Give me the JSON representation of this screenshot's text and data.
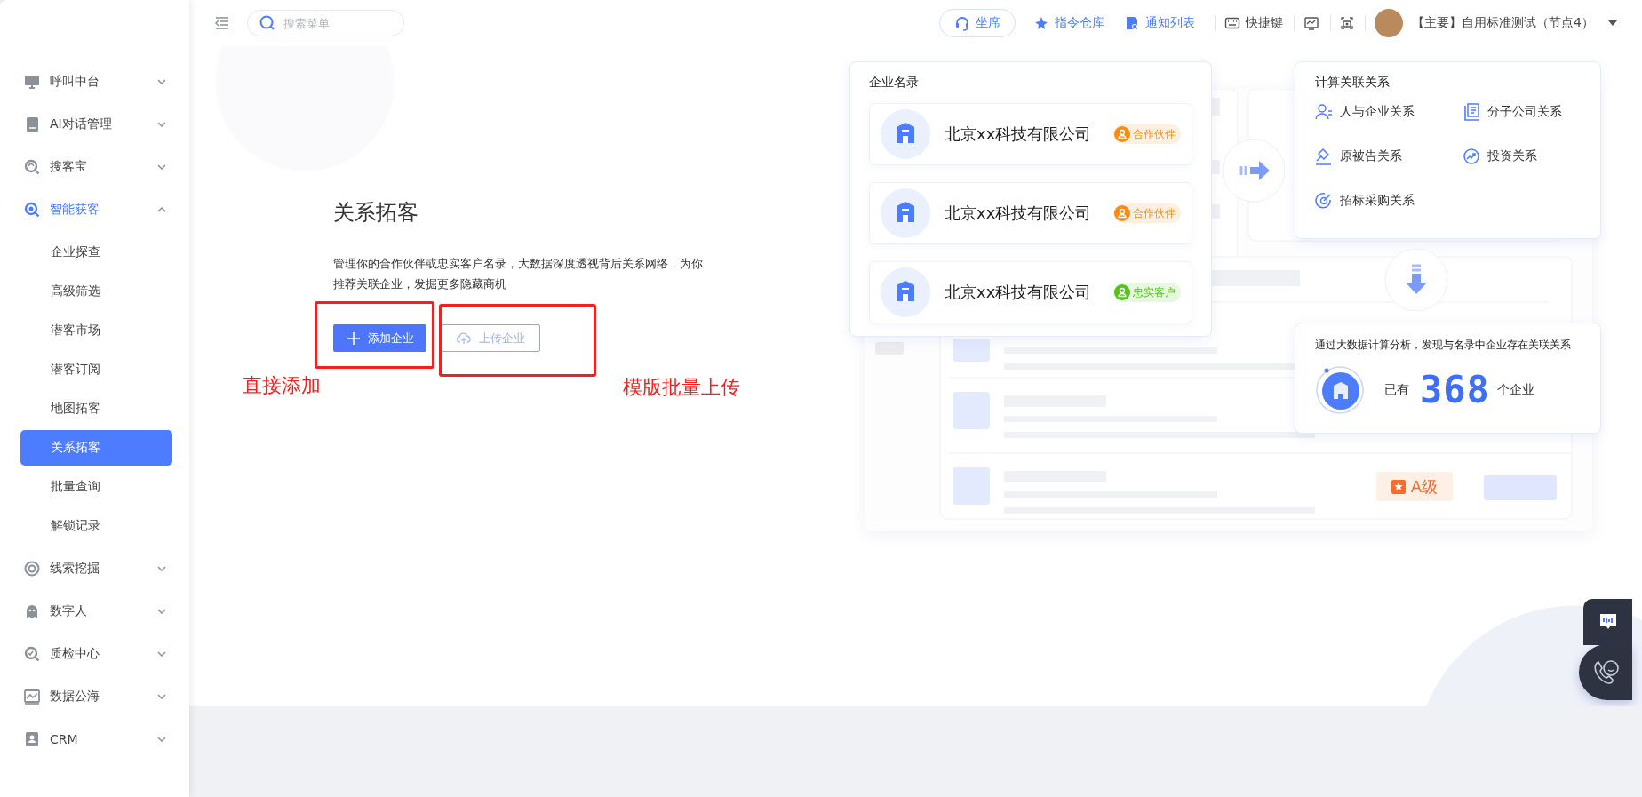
{
  "topbar": {
    "search": {
      "placeholder": "搜索菜单"
    },
    "actions": [
      {
        "label": "坐席",
        "kind": "pill"
      },
      {
        "label": "指令仓库",
        "kind": "link"
      },
      {
        "label": "通知列表",
        "kind": "link"
      },
      {
        "label": "快捷键",
        "kind": "plain"
      }
    ],
    "user": {
      "name": "【主要】自用标准测试（节点4）"
    }
  },
  "sidebar": {
    "items": [
      {
        "label": "呼叫中台",
        "expanded": false
      },
      {
        "label": "AI对话管理",
        "expanded": false
      },
      {
        "label": "搜客宝",
        "expanded": false
      },
      {
        "label": "智能获客",
        "expanded": true,
        "children": [
          {
            "label": "企业探查",
            "selected": false
          },
          {
            "label": "高级筛选",
            "selected": false
          },
          {
            "label": "潜客市场",
            "selected": false
          },
          {
            "label": "潜客订阅",
            "selected": false
          },
          {
            "label": "地图拓客",
            "selected": false
          },
          {
            "label": "关系拓客",
            "selected": true
          },
          {
            "label": "批量查询",
            "selected": false
          },
          {
            "label": "解锁记录",
            "selected": false
          }
        ]
      },
      {
        "label": "线索挖掘",
        "expanded": false
      },
      {
        "label": "数字人",
        "expanded": false
      },
      {
        "label": "质检中心",
        "expanded": false
      },
      {
        "label": "数据公海",
        "expanded": false
      },
      {
        "label": "CRM",
        "expanded": false
      }
    ]
  },
  "page": {
    "title": "关系拓客",
    "description": "管理你的合作伙伴或忠实客户名录，大数据深度透视背后关系网络，为你推荐关联企业，发掘更多隐藏商机",
    "buttons": [
      {
        "label": "添加企业",
        "kind": "primary"
      },
      {
        "label": "上传企业",
        "kind": "outline"
      }
    ]
  },
  "annotations": [
    {
      "label": "直接添加"
    },
    {
      "label": "模版批量上传"
    }
  ],
  "illustration": {
    "directory": {
      "title": "企业名录",
      "companies": [
        {
          "name": "北京xx科技有限公司",
          "tag": "合作伙伴",
          "color": "#fa8c16"
        },
        {
          "name": "北京xx科技有限公司",
          "tag": "合作伙伴",
          "color": "#fa8c16"
        },
        {
          "name": "北京xx科技有限公司",
          "tag": "忠实客户",
          "color": "#52c41a"
        }
      ]
    },
    "relations": {
      "title": "计算关联关系",
      "items": [
        "人与企业关系",
        "分子公司关系",
        "原被告关系",
        "投资关系",
        "招标采购关系"
      ]
    },
    "result": {
      "text": "通过大数据计算分析，发现与名录中企业存在关联关系",
      "prefix": "已有",
      "count": "368",
      "suffix": "个企业"
    },
    "grade": "A级"
  }
}
